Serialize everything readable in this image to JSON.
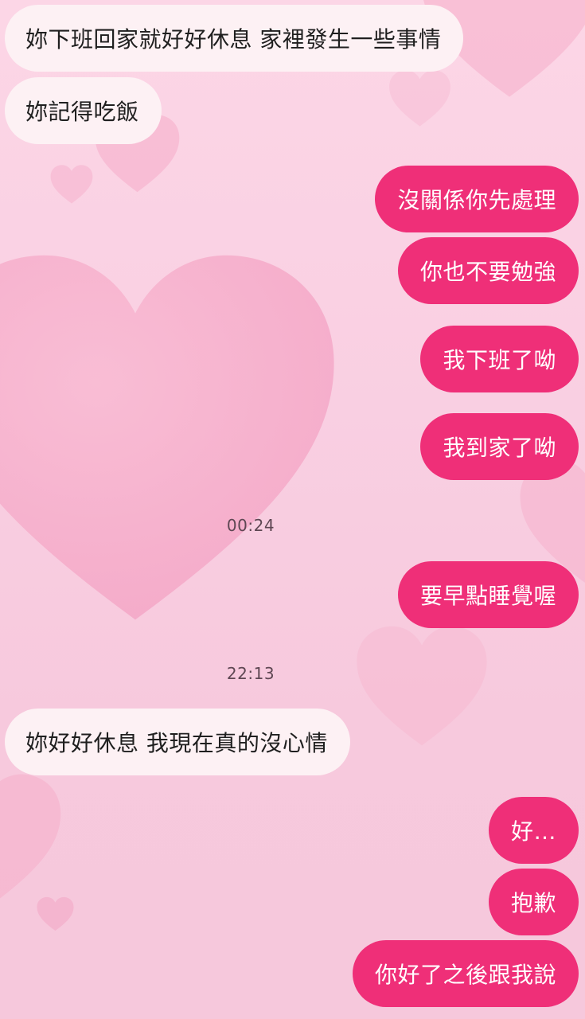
{
  "colors": {
    "incoming_bubble": "#fdf1f4",
    "outgoing_bubble": "#ef2f78",
    "incoming_text": "#1f1f1f",
    "outgoing_text": "#ffffff",
    "timestamp_text": "#5e4753",
    "background": "#f9cfe2"
  },
  "background": {
    "theme": "pink-hearts"
  },
  "messages": [
    {
      "direction": "incoming",
      "text": "妳下班回家就好好休息 家裡發生一些事情"
    },
    {
      "direction": "incoming",
      "text": "妳記得吃飯"
    },
    {
      "direction": "outgoing",
      "text": "沒關係你先處理"
    },
    {
      "direction": "outgoing",
      "text": "你也不要勉強"
    },
    {
      "direction": "outgoing",
      "text": "我下班了呦"
    },
    {
      "direction": "outgoing",
      "text": "我到家了呦"
    },
    {
      "type": "timestamp",
      "text": "00:24"
    },
    {
      "direction": "outgoing",
      "text": "要早點睡覺喔"
    },
    {
      "type": "timestamp",
      "text": "22:13"
    },
    {
      "direction": "incoming",
      "text": "妳好好休息 我現在真的沒心情"
    },
    {
      "direction": "outgoing",
      "text": "好…"
    },
    {
      "direction": "outgoing",
      "text": "抱歉"
    },
    {
      "direction": "outgoing",
      "text": "你好了之後跟我說"
    }
  ]
}
